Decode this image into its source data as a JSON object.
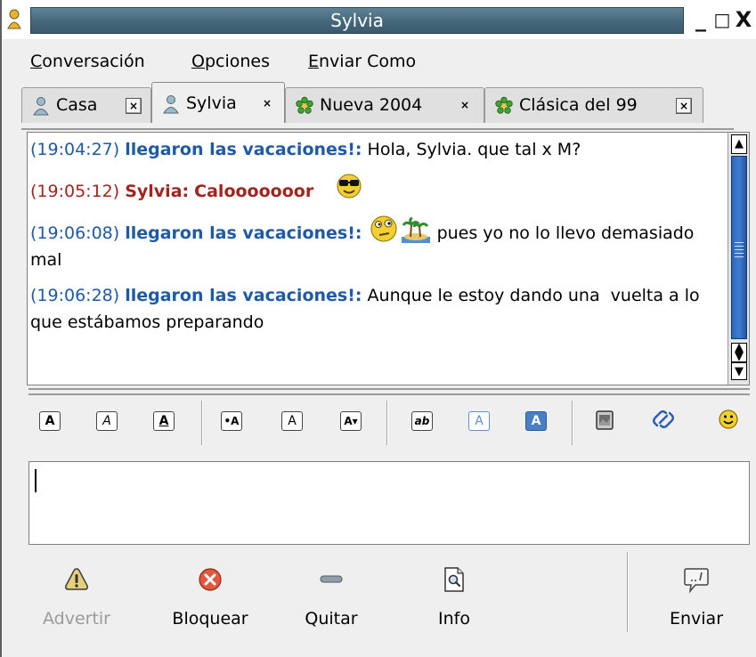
{
  "window": {
    "title": "Sylvia",
    "minimize_label": "_",
    "maximize_label": "□",
    "close_label": "X",
    "accent": "#45677a"
  },
  "menu": {
    "items": [
      {
        "label": "Conversación",
        "mnemonic": "C"
      },
      {
        "label": "Opciones",
        "mnemonic": "O"
      },
      {
        "label": "Enviar Como",
        "mnemonic": "E"
      }
    ]
  },
  "tabs": [
    {
      "label": "Casa",
      "icon": "buddy-person-icon",
      "active": false
    },
    {
      "label": "Sylvia",
      "icon": "buddy-person-icon",
      "active": true
    },
    {
      "label": "Nueva 2004",
      "icon": "icq-flower-icon",
      "active": false
    },
    {
      "label": "Clásica del 99",
      "icon": "icq-flower-icon",
      "active": false
    }
  ],
  "conversation": {
    "messages": [
      {
        "time": "(19:04:27)",
        "sender": "llegaron las vacaciones!:",
        "text": "Hola, Sylvia. que tal x M?",
        "self": true,
        "emoticons": []
      },
      {
        "time": "(19:05:12)",
        "sender": "Sylvia:",
        "text": "Calooooooor",
        "self": false,
        "emoticons": [
          "sunglasses-smiley-icon"
        ]
      },
      {
        "time": "(19:06:08)",
        "sender": "llegaron las vacaciones!:",
        "text": "pues yo no lo llevo demasiado mal",
        "self": true,
        "emoticons": [
          "thinking-smiley-icon",
          "palm-island-icon"
        ]
      },
      {
        "time": "(19:06:28)",
        "sender": "llegaron las vacaciones!:",
        "text": "Aunque le estoy dando una  vuelta a lo que estábamos preparando",
        "self": true,
        "emoticons": []
      }
    ],
    "self_color": "#1f5aa6",
    "other_color": "#a2241e"
  },
  "format_toolbar": {
    "buttons": [
      {
        "glyph": "A",
        "name": "bold-icon"
      },
      {
        "glyph": "A",
        "name": "italic-icon"
      },
      {
        "glyph": "A",
        "name": "underline-icon"
      },
      {
        "glyph": "•A",
        "name": "larger-font-icon"
      },
      {
        "glyph": "A",
        "name": "normal-font-icon"
      },
      {
        "glyph": "A▾",
        "name": "smaller-font-icon"
      },
      {
        "glyph": "ab",
        "name": "font-face-icon"
      },
      {
        "glyph": "A",
        "name": "foreground-color-icon"
      },
      {
        "glyph": "A",
        "name": "background-color-icon"
      },
      {
        "glyph": "",
        "name": "insert-image-icon"
      },
      {
        "glyph": "",
        "name": "insert-link-icon"
      },
      {
        "glyph": "",
        "name": "insert-smiley-icon"
      }
    ]
  },
  "input": {
    "value": ""
  },
  "actions": {
    "warn": {
      "label": "Advertir",
      "icon": "warning-triangle-icon",
      "enabled": false
    },
    "block": {
      "label": "Bloquear",
      "icon": "block-x-circle-icon",
      "enabled": true
    },
    "remove": {
      "label": "Quitar",
      "icon": "minus-icon",
      "enabled": true
    },
    "info": {
      "label": "Info",
      "icon": "info-magnifier-icon",
      "enabled": true
    },
    "send": {
      "label": "Enviar",
      "icon": "speech-bubble-icon",
      "enabled": true
    }
  }
}
